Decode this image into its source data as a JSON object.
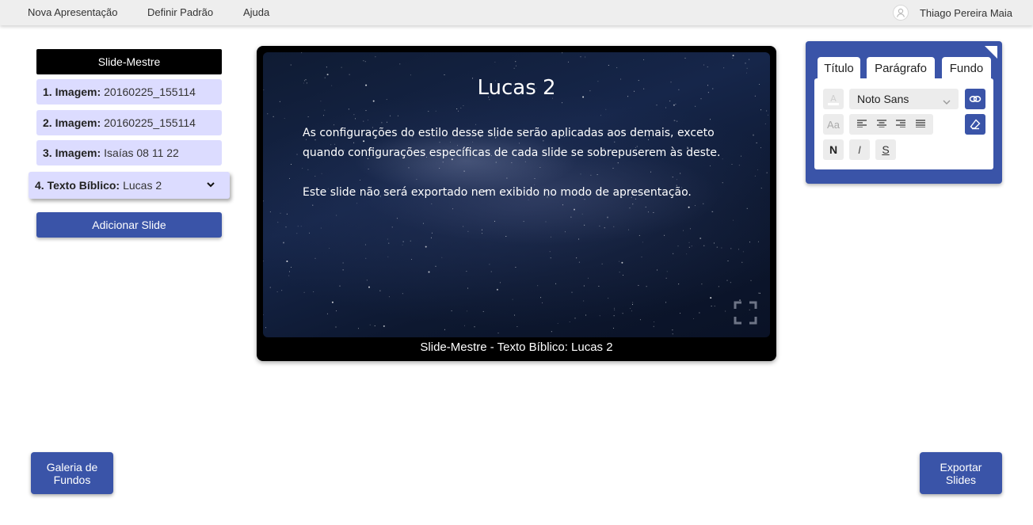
{
  "menu": {
    "items": [
      "Nova Apresentação",
      "Definir Padrão",
      "Ajuda"
    ],
    "user_name": "Thiago Pereira Maia"
  },
  "sidebar": {
    "master_label": "Slide-Mestre",
    "slides": [
      {
        "prefix": "1. Imagem:",
        "name": "20160225_155114"
      },
      {
        "prefix": "2. Imagem:",
        "name": "20160225_155114"
      },
      {
        "prefix": "3. Imagem:",
        "name": "Isaías 08 11 22"
      },
      {
        "prefix": "4. Texto Bíblico:",
        "name": "Lucas 2"
      }
    ],
    "add_slide_label": "Adicionar Slide"
  },
  "preview": {
    "title": "Lucas 2",
    "paragraph_1": "As configurações do estilo desse slide serão aplicadas aos demais, exceto quando configurações específicas de cada slide se sobrepuserem às deste.",
    "paragraph_2": "Este slide não será exportado nem exibido no modo de apresentação.",
    "caption": "Slide-Mestre - Texto Bíblico: Lucas 2"
  },
  "style_panel": {
    "tabs": [
      "Título",
      "Parágrafo",
      "Fundo"
    ],
    "font_family_value": "Noto Sans",
    "case_label": "Aa",
    "bold_label": "N",
    "italic_label": "I",
    "strike_label": "S"
  },
  "bottom": {
    "gallery_line1": "Galeria de",
    "gallery_line2": "Fundos",
    "export_line1": "Exportar",
    "export_line2": "Slides"
  },
  "colors": {
    "accent": "#3a54a8",
    "slide_item_bg": "#dcdcff",
    "topbar_bg": "#eeeeee"
  },
  "icons": [
    "user-avatar-icon",
    "chevron-down-icon",
    "fullscreen-icon",
    "panel-corner-icon",
    "font-color-icon",
    "link-icon",
    "eraser-icon",
    "align-left-icon",
    "align-center-icon",
    "align-right-icon",
    "align-justify-icon"
  ]
}
